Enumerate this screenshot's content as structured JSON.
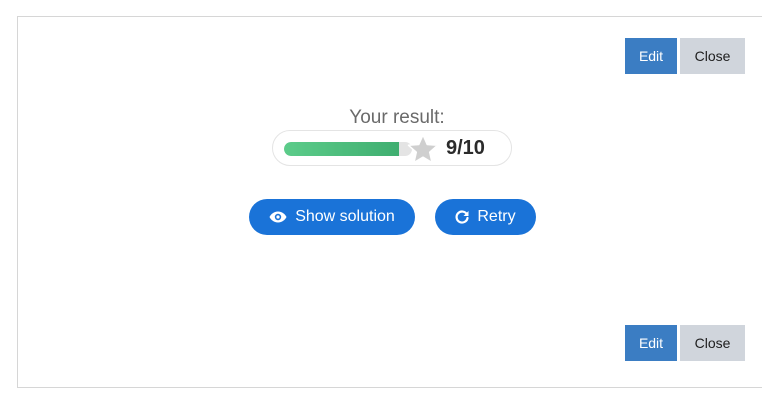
{
  "toolbar": {
    "edit_label": "Edit",
    "close_label": "Close"
  },
  "result": {
    "label": "Your result:",
    "score_text": "9/10",
    "score": 9,
    "max_score": 10,
    "progress_fraction": 0.9
  },
  "actions": {
    "show_solution_label": "Show solution",
    "retry_label": "Retry"
  },
  "icons": {
    "solution": "eye-icon",
    "retry": "refresh-icon",
    "result": "star-icon"
  },
  "colors": {
    "edit_button": "#3b7dc3",
    "close_button": "#d0d5dc",
    "pill_button": "#1a73d8",
    "progress_fill": "#4cbf7e",
    "star": "#cfcfcf"
  }
}
